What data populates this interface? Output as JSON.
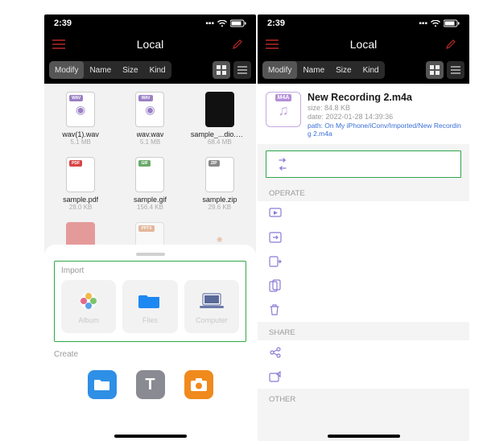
{
  "left": {
    "status": {
      "time": "2:39"
    },
    "nav": {
      "title": "Local"
    },
    "filters": {
      "modify": "Modify",
      "name": "Name",
      "size": "Size",
      "kind": "Kind"
    },
    "files": [
      {
        "badge": "WAV",
        "badgeClass": "wav",
        "glyph": "▶",
        "name": "wav(1).wav",
        "meta": "5.1 MB"
      },
      {
        "badge": "WAV",
        "badgeClass": "wav",
        "glyph": "▶",
        "name": "wav.wav",
        "meta": "5.1 MB"
      },
      {
        "badge": "",
        "badgeClass": "",
        "glyph": "",
        "name": "sample_...dio.mov",
        "meta": "68.4 MB",
        "black": true
      },
      {
        "badge": "PDF",
        "badgeClass": "pdf",
        "glyph": "",
        "name": "sample.pdf",
        "meta": "28.0 KB"
      },
      {
        "badge": "GIF",
        "badgeClass": "gif",
        "glyph": "",
        "name": "sample.gif",
        "meta": "156.4 KB"
      },
      {
        "badge": "ZIP",
        "badgeClass": "zip",
        "glyph": "",
        "name": "sample.zip",
        "meta": "29.6 KB"
      },
      {
        "badge": "",
        "badgeClass": "",
        "glyph": "",
        "name": "",
        "meta": ""
      },
      {
        "badge": "PPTX",
        "badgeClass": "pptx",
        "glyph": "",
        "name": "",
        "meta": ""
      },
      {
        "badge": "",
        "badgeClass": "",
        "glyph": "",
        "name": "",
        "meta": ""
      }
    ],
    "sheet": {
      "import_label": "Import",
      "tiles": {
        "album": "Album",
        "files": "Files",
        "computer": "Computer"
      },
      "create_label": "Create"
    }
  },
  "right": {
    "status": {
      "time": "2:39"
    },
    "nav": {
      "title": "Local"
    },
    "filters": {
      "modify": "Modify",
      "name": "Name",
      "size": "Size",
      "kind": "Kind"
    },
    "detail": {
      "icon_label": "M4A",
      "title": "New Recording 2.m4a",
      "size": "size: 84.8 KB",
      "date": "date: 2022-01-28 14:39:36",
      "path": "path: On My iPhone/iConv/Imported/New Recording 2.m4a"
    },
    "groups": {
      "operate": "OPERATE",
      "share": "SHARE",
      "other": "OTHER"
    }
  }
}
